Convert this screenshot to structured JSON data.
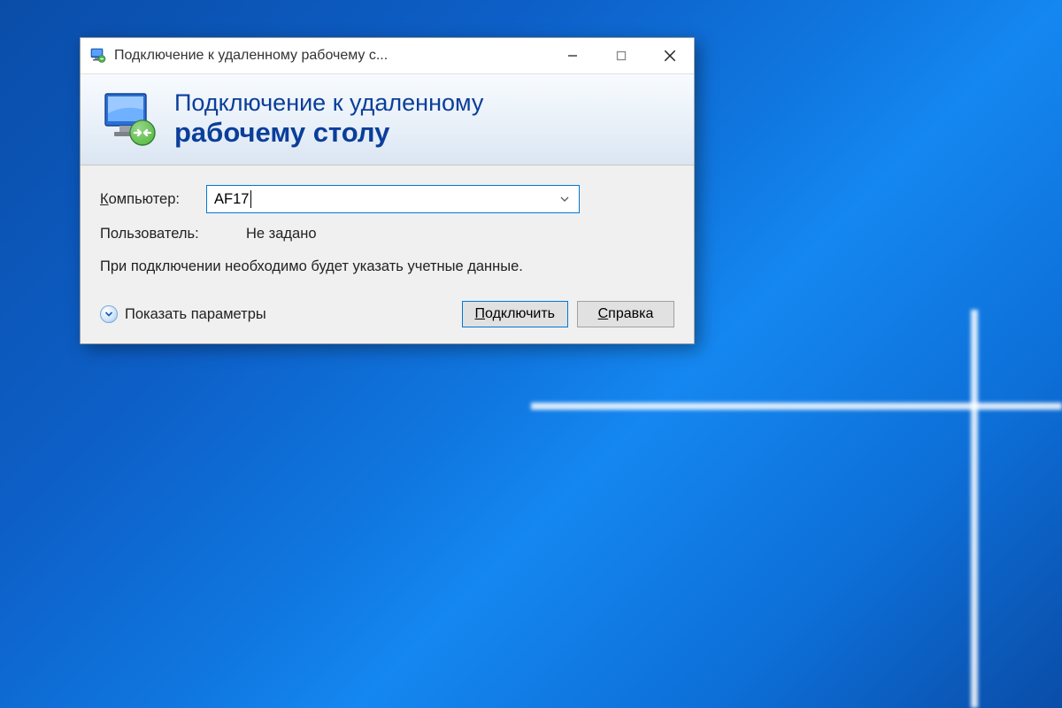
{
  "titlebar": {
    "title": "Подключение к удаленному рабочему с..."
  },
  "header": {
    "line1": "Подключение к удаленному",
    "line2": "рабочему столу"
  },
  "form": {
    "computer_label_prefix": "К",
    "computer_label_rest": "омпьютер:",
    "computer_value": "AF17",
    "user_label": "Пользователь:",
    "user_value": "Не задано",
    "info_text": "При подключении необходимо будет указать учетные данные."
  },
  "footer": {
    "show_options_prefix": "П",
    "show_options_rest": "оказать параметры",
    "connect_prefix": "П",
    "connect_rest": "одключить",
    "help_prefix": "С",
    "help_rest": "правка"
  }
}
